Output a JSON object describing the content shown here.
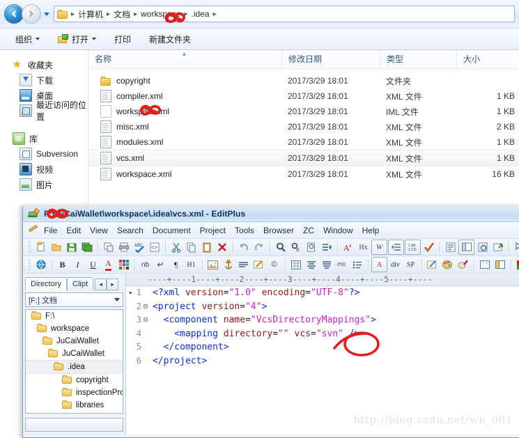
{
  "explorer": {
    "nav": {
      "back_label": "Back",
      "forward_label": "Forward",
      "recent_label": "Recent pages"
    },
    "breadcrumb": [
      {
        "label": "计算机"
      },
      {
        "label": "文档"
      },
      {
        "label": "workspace"
      },
      {
        "label": ".idea"
      }
    ],
    "toolbar": [
      {
        "label": "组织",
        "caret": true
      },
      {
        "label": "打开",
        "caret": true,
        "icon": "open-icon"
      },
      {
        "label": "打印",
        "caret": false
      },
      {
        "label": "新建文件夹",
        "caret": false
      }
    ],
    "sidebar": [
      {
        "label": "收藏夹",
        "icon": "star-icon",
        "level": 0
      },
      {
        "label": "下载",
        "icon": "download-icon",
        "level": 1
      },
      {
        "label": "桌面",
        "icon": "desktop-icon",
        "level": 1
      },
      {
        "label": "最近访问的位置",
        "icon": "recent-places-icon",
        "level": 1
      },
      {
        "label": "库",
        "icon": "library-icon",
        "level": 0
      },
      {
        "label": "Subversion",
        "icon": "subversion-icon",
        "level": 1
      },
      {
        "label": "视频",
        "icon": "video-icon",
        "level": 1
      },
      {
        "label": "图片",
        "icon": "pictures-icon",
        "level": 1
      }
    ],
    "columns": [
      "名称",
      "修改日期",
      "类型",
      "大小"
    ],
    "files": [
      {
        "name": "copyright",
        "date": "2017/3/29 18:01",
        "type": "文件夹",
        "size": "",
        "icon": "folder-icon",
        "selected": false
      },
      {
        "name": "compiler.xml",
        "date": "2017/3/29 18:01",
        "type": "XML 文件",
        "size": "1 KB",
        "icon": "xml-file-icon",
        "selected": false
      },
      {
        "name": "workspace.iml",
        "date": "2017/3/29 18:01",
        "type": "IML 文件",
        "size": "1 KB",
        "icon": "iml-file-icon",
        "selected": false
      },
      {
        "name": "misc.xml",
        "date": "2017/3/29 18:01",
        "type": "XML 文件",
        "size": "2 KB",
        "icon": "xml-file-icon",
        "selected": false
      },
      {
        "name": "modules.xml",
        "date": "2017/3/29 18:01",
        "type": "XML 文件",
        "size": "1 KB",
        "icon": "xml-file-icon",
        "selected": false
      },
      {
        "name": "vcs.xml",
        "date": "2017/3/29 18:01",
        "type": "XML 文件",
        "size": "1 KB",
        "icon": "xml-file-icon",
        "selected": true
      },
      {
        "name": "workspace.xml",
        "date": "2017/3/29 18:01",
        "type": "XML 文件",
        "size": "16 KB",
        "icon": "xml-file-icon",
        "selected": false
      }
    ]
  },
  "editplus": {
    "title": "F:\\JuCaiWallet\\workspace\\.idea\\vcs.xml - EditPlus",
    "menu": [
      "File",
      "Edit",
      "View",
      "Search",
      "Document",
      "Project",
      "Tools",
      "Browser",
      "ZC",
      "Window",
      "Help"
    ],
    "toolbar_row1": [
      {
        "icon": "new-file-icon"
      },
      {
        "icon": "open-file-icon"
      },
      {
        "icon": "save-icon"
      },
      {
        "icon": "save-all-icon"
      },
      {
        "icon": "separator"
      },
      {
        "icon": "print-preview-icon"
      },
      {
        "icon": "print-icon"
      },
      {
        "icon": "spell-check-icon"
      },
      {
        "icon": "html-source-icon"
      },
      {
        "icon": "separator"
      },
      {
        "icon": "cut-icon"
      },
      {
        "icon": "copy-icon"
      },
      {
        "icon": "paste-icon"
      },
      {
        "icon": "delete-icon"
      },
      {
        "icon": "separator"
      },
      {
        "icon": "undo-icon"
      },
      {
        "icon": "redo-icon"
      },
      {
        "icon": "separator"
      },
      {
        "icon": "find-icon"
      },
      {
        "icon": "replace-icon"
      },
      {
        "icon": "find-in-files-icon"
      },
      {
        "icon": "goto-line-icon"
      },
      {
        "icon": "separator"
      },
      {
        "icon": "change-case-icon"
      },
      {
        "icon": "hex-view-icon"
      },
      {
        "icon": "word-wrap-icon"
      },
      {
        "icon": "auto-indent-icon"
      },
      {
        "icon": "show-spaces-icon"
      },
      {
        "icon": "check-icon"
      },
      {
        "icon": "separator"
      },
      {
        "icon": "document-selector-icon"
      },
      {
        "icon": "directory-window-icon"
      },
      {
        "icon": "output-window-icon"
      },
      {
        "icon": "user-tools-icon"
      },
      {
        "icon": "separator"
      },
      {
        "icon": "context-help-icon"
      }
    ],
    "toolbar_row2": [
      {
        "icon": "browser-preview-icon"
      },
      {
        "icon": "separator"
      },
      {
        "icon": "bold-icon",
        "glyph": "B"
      },
      {
        "icon": "italic-icon",
        "glyph": "I"
      },
      {
        "icon": "underline-icon",
        "glyph": "U"
      },
      {
        "icon": "font-color-icon",
        "glyph": "A"
      },
      {
        "icon": "color-palette-icon"
      },
      {
        "icon": "separator"
      },
      {
        "icon": "nbsp-icon",
        "glyph": "nb"
      },
      {
        "icon": "line-break-icon"
      },
      {
        "icon": "paragraph-icon"
      },
      {
        "icon": "heading-icon",
        "glyph": "H1"
      },
      {
        "icon": "separator"
      },
      {
        "icon": "image-icon"
      },
      {
        "icon": "anchor-icon"
      },
      {
        "icon": "horizontal-rule-icon"
      },
      {
        "icon": "edit-link-icon"
      },
      {
        "icon": "copyright-icon"
      },
      {
        "icon": "separator"
      },
      {
        "icon": "table-icon"
      },
      {
        "icon": "align-center-icon"
      },
      {
        "icon": "align-justify-icon"
      },
      {
        "icon": "preformatted-icon",
        "glyph": "PRE"
      },
      {
        "icon": "list-icon"
      },
      {
        "icon": "separator"
      },
      {
        "icon": "font-tag-icon",
        "glyph": "A"
      },
      {
        "icon": "div-tag-icon",
        "glyph": "div"
      },
      {
        "icon": "span-tag-icon",
        "glyph": "SP"
      },
      {
        "icon": "separator"
      },
      {
        "icon": "style-edit-icon"
      },
      {
        "icon": "palette-brush-icon"
      },
      {
        "icon": "color-picker-icon"
      },
      {
        "icon": "separator"
      },
      {
        "icon": "form-icon"
      },
      {
        "icon": "frame-icon"
      },
      {
        "icon": "separator"
      },
      {
        "icon": "color-swatch-icon"
      },
      {
        "icon": "tag-list-icon"
      }
    ],
    "panel": {
      "tabs": [
        {
          "label": "Directory",
          "active": true
        },
        {
          "label": "Clipt",
          "active": false
        }
      ],
      "tab_scroll_left": "◄",
      "tab_scroll_right": "►",
      "drive_combo": "[F:] 文档",
      "tree": [
        {
          "label": "F:\\",
          "indent": 0,
          "selected": false
        },
        {
          "label": "workspace",
          "indent": 1,
          "selected": false
        },
        {
          "label": "JuCaiWallet",
          "indent": 2,
          "selected": false
        },
        {
          "label": "JuCaiWallet",
          "indent": 3,
          "selected": false
        },
        {
          "label": ".idea",
          "indent": 4,
          "selected": true
        },
        {
          "label": "copyright",
          "indent": 5,
          "selected": false
        },
        {
          "label": "inspectionPro",
          "indent": 5,
          "selected": false
        },
        {
          "label": "libraries",
          "indent": 5,
          "selected": false
        }
      ]
    },
    "editor": {
      "ruler": "----+----1----+----2----+----3----+----4----+----5----+----",
      "lines": [
        {
          "num": "1",
          "fold": "",
          "marker": "▸",
          "tokens": [
            {
              "t": "<?xml ",
              "c": "pi"
            },
            {
              "t": "version",
              "c": "attr"
            },
            {
              "t": "=",
              "c": "plain"
            },
            {
              "t": "\"1.0\"",
              "c": "val"
            },
            {
              "t": " ",
              "c": "plain"
            },
            {
              "t": "encoding",
              "c": "attr"
            },
            {
              "t": "=",
              "c": "plain"
            },
            {
              "t": "\"UTF-8\"",
              "c": "val"
            },
            {
              "t": "?>",
              "c": "pi"
            }
          ]
        },
        {
          "num": "2",
          "fold": "⊟",
          "marker": "",
          "tokens": [
            {
              "t": "<project ",
              "c": "tag"
            },
            {
              "t": "version",
              "c": "attr"
            },
            {
              "t": "=",
              "c": "plain"
            },
            {
              "t": "\"4\"",
              "c": "val"
            },
            {
              "t": ">",
              "c": "tag"
            }
          ]
        },
        {
          "num": "3",
          "fold": "⊟",
          "marker": "",
          "tokens": [
            {
              "t": "  <component ",
              "c": "tag"
            },
            {
              "t": "name",
              "c": "attr"
            },
            {
              "t": "=",
              "c": "plain"
            },
            {
              "t": "\"VcsDirectoryMappings\"",
              "c": "val"
            },
            {
              "t": ">",
              "c": "tag"
            }
          ]
        },
        {
          "num": "4",
          "fold": "",
          "marker": "",
          "tokens": [
            {
              "t": "    <mapping ",
              "c": "tag"
            },
            {
              "t": "directory",
              "c": "attr"
            },
            {
              "t": "=",
              "c": "plain"
            },
            {
              "t": "\"\"",
              "c": "val"
            },
            {
              "t": " ",
              "c": "plain"
            },
            {
              "t": "vcs",
              "c": "attr"
            },
            {
              "t": "=",
              "c": "plain"
            },
            {
              "t": "\"svn\"",
              "c": "val"
            },
            {
              "t": " />",
              "c": "tag"
            }
          ]
        },
        {
          "num": "5",
          "fold": "",
          "marker": "",
          "tokens": [
            {
              "t": "  </component>",
              "c": "tag"
            }
          ]
        },
        {
          "num": "6",
          "fold": "",
          "marker": "",
          "tokens": [
            {
              "t": "</project>",
              "c": "tag"
            }
          ]
        }
      ]
    },
    "watermark": "http://blog.csdn.net/wb_001"
  },
  "annotations": {
    "color": "#e02020",
    "items": [
      {
        "name": "breadcrumb-scribble",
        "target": "workspace breadcrumb"
      },
      {
        "name": "filename-scribble",
        "target": "workspace.iml"
      },
      {
        "name": "titlebar-scribble",
        "target": "EditPlus title path"
      },
      {
        "name": "svn-circle",
        "target": "svn attribute value"
      }
    ]
  }
}
